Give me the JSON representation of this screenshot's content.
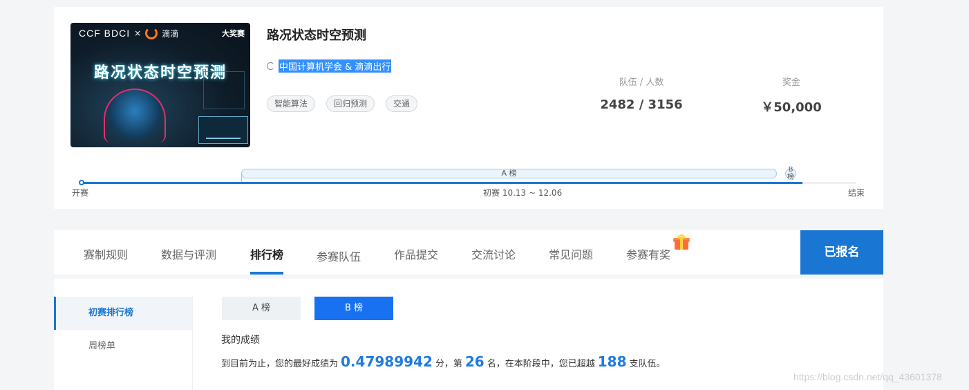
{
  "competition": {
    "banner": {
      "ccf_logo_text": "CCF BDCI",
      "times": "×",
      "didi_text": "滴滴",
      "badge": "大奖赛",
      "title": "路况状态时空预测"
    },
    "title": "路况状态时空预测",
    "organizer": "中国计算机学会 & 滴滴出行",
    "tags": [
      "智能算法",
      "回归预测",
      "交通"
    ],
    "stats": {
      "teams_label": "队伍 / 人数",
      "teams_value": "2482 / 3156",
      "prize_label": "奖金",
      "prize_value": "￥50,000"
    },
    "timeline": {
      "start_label": "开赛",
      "end_label": "结束",
      "stage_a": "A 榜",
      "stage_b": "B 榜",
      "prelim_label": "初赛 10.13 ~ 12.06",
      "progress": 0.93
    }
  },
  "tabs": {
    "items": [
      "赛制规则",
      "数据与评测",
      "排行榜",
      "参赛队伍",
      "作品提交",
      "交流讨论",
      "常见问题",
      "参赛有奖"
    ],
    "active": "排行榜",
    "signed_button": "已报名"
  },
  "leaderboard": {
    "sidebar": [
      "初赛排行榜",
      "周榜单"
    ],
    "board_a": "A 榜",
    "board_b": "B 榜",
    "my_heading": "我的成绩",
    "result": {
      "prefix": "到目前为止，您的最好成绩为",
      "score": "0.47989942",
      "mid1": "分，第",
      "rank": "26",
      "mid2": "名，在本阶段中，您已超越",
      "surpassed": "188",
      "suffix": "支队伍。"
    }
  },
  "watermark": "https://blog.csdn.net/qq_43601378",
  "colors": {
    "primary": "#1976d2",
    "selection": "#3390ff",
    "score": "#1f7ae0"
  }
}
